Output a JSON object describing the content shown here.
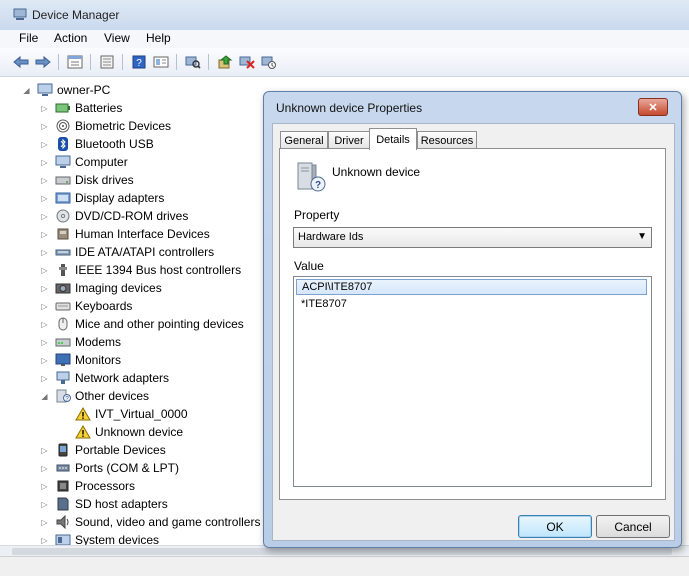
{
  "window": {
    "title": "Device Manager"
  },
  "menu": [
    "File",
    "Action",
    "View",
    "Help"
  ],
  "toolbar": {
    "icons": [
      "back-icon",
      "forward-icon",
      "properties-icon",
      "driver-icon",
      "help-icon",
      "show-hidden-icon",
      "scan-hardware-icon",
      "update-driver-icon",
      "uninstall-icon",
      "disable-icon"
    ]
  },
  "tree": {
    "root": "owner-PC",
    "categories": [
      {
        "label": "Batteries",
        "icon": "battery-icon"
      },
      {
        "label": "Biometric Devices",
        "icon": "fingerprint-icon"
      },
      {
        "label": "Bluetooth USB",
        "icon": "bluetooth-icon"
      },
      {
        "label": "Computer",
        "icon": "computer-icon"
      },
      {
        "label": "Disk drives",
        "icon": "disk-icon"
      },
      {
        "label": "Display adapters",
        "icon": "display-icon"
      },
      {
        "label": "DVD/CD-ROM drives",
        "icon": "dvd-icon"
      },
      {
        "label": "Human Interface Devices",
        "icon": "hid-icon"
      },
      {
        "label": "IDE ATA/ATAPI controllers",
        "icon": "ide-icon"
      },
      {
        "label": "IEEE 1394 Bus host controllers",
        "icon": "ieee1394-icon"
      },
      {
        "label": "Imaging devices",
        "icon": "camera-icon"
      },
      {
        "label": "Keyboards",
        "icon": "keyboard-icon"
      },
      {
        "label": "Mice and other pointing devices",
        "icon": "mouse-icon"
      },
      {
        "label": "Modems",
        "icon": "modem-icon"
      },
      {
        "label": "Monitors",
        "icon": "monitor-icon"
      },
      {
        "label": "Network adapters",
        "icon": "network-icon"
      },
      {
        "label": "Other devices",
        "icon": "other-devices-icon",
        "expanded": true,
        "children": [
          {
            "label": "IVT_Virtual_0000"
          },
          {
            "label": "Unknown device"
          }
        ]
      },
      {
        "label": "Portable Devices",
        "icon": "portable-icon"
      },
      {
        "label": "Ports (COM & LPT)",
        "icon": "port-icon"
      },
      {
        "label": "Processors",
        "icon": "processor-icon"
      },
      {
        "label": "SD host adapters",
        "icon": "sd-icon"
      },
      {
        "label": "Sound, video and game controllers",
        "icon": "sound-icon"
      },
      {
        "label": "System devices",
        "icon": "system-icon"
      }
    ]
  },
  "dialog": {
    "title": "Unknown device Properties",
    "close_label": "✕",
    "tabs": [
      {
        "label": "General",
        "active": false
      },
      {
        "label": "Driver",
        "active": false
      },
      {
        "label": "Details",
        "active": true
      },
      {
        "label": "Resources",
        "active": false
      }
    ],
    "device_name": "Unknown device",
    "property_label": "Property",
    "property_value": "Hardware Ids",
    "value_label": "Value",
    "values": [
      "ACPI\\ITE8707",
      "*ITE8707"
    ],
    "ok_label": "OK",
    "cancel_label": "Cancel"
  }
}
